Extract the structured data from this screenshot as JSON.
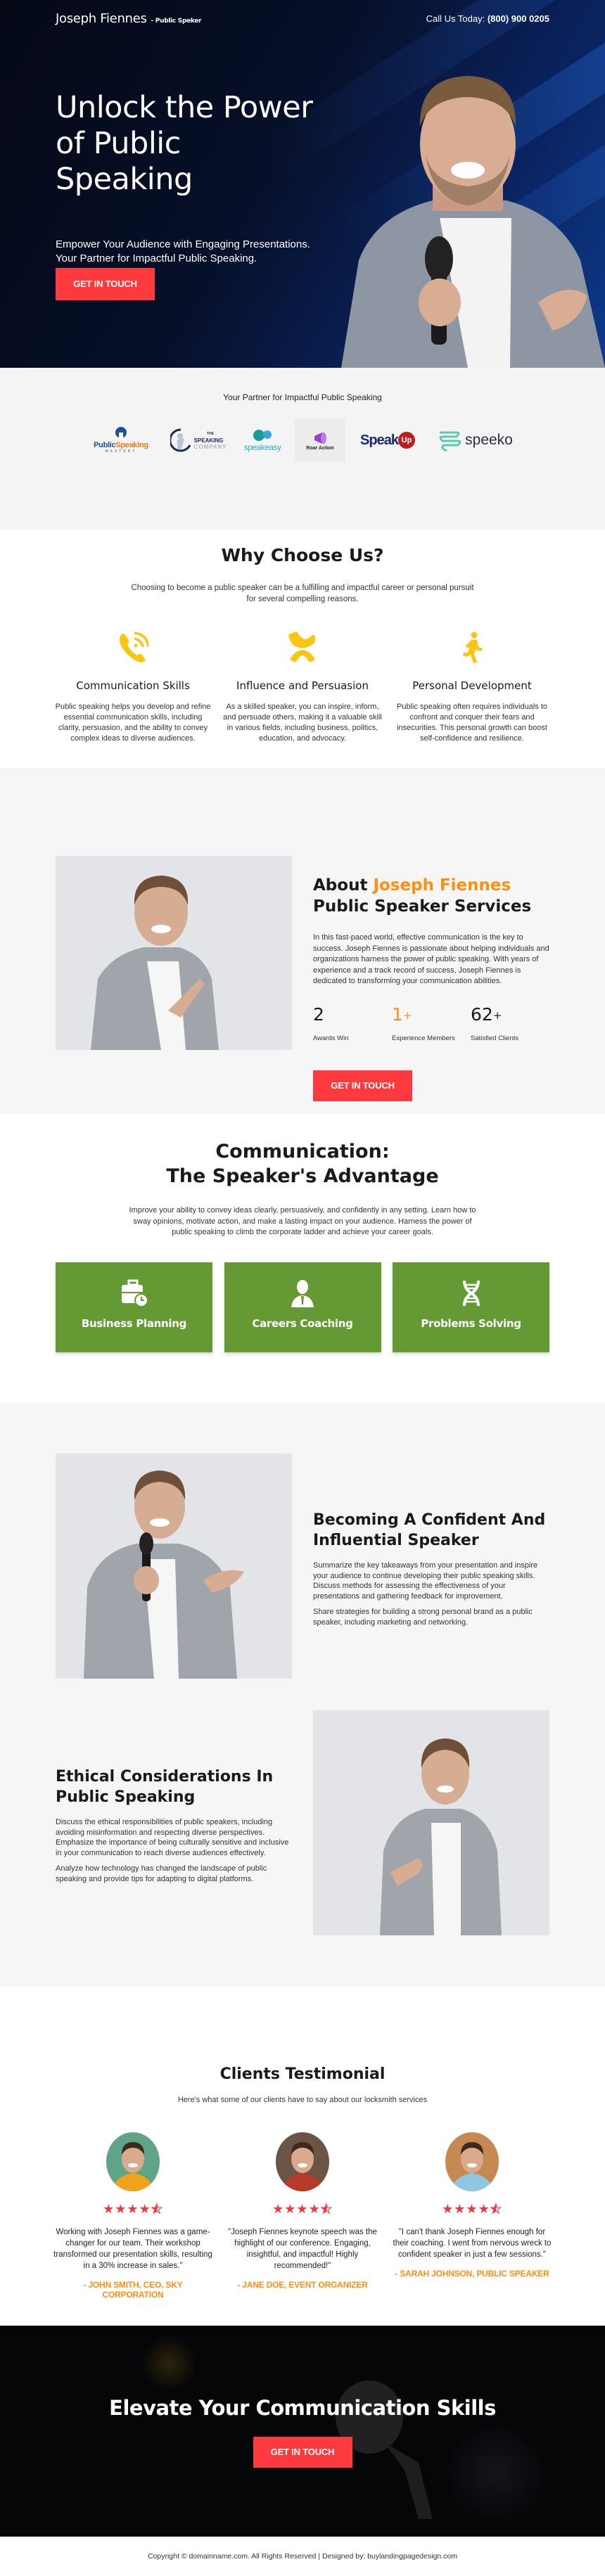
{
  "header": {
    "brand": "Joseph Fiennes",
    "brand_tag": "- Public Speker",
    "phone_label": "Call Us Today:",
    "phone_number": "(800) 900 0205"
  },
  "hero": {
    "title": "Unlock the Power of Public Speaking",
    "subtitle": "Empower Your Audience with Engaging Presentations. Your Partner for Impactful Public Speaking.",
    "cta": "GET IN TOUCH"
  },
  "partners": {
    "title": "Your Partner for Impactful Public Speaking",
    "logos": [
      {
        "name": "Public Speaking Mastery",
        "part1": "Public",
        "part2": "Speaking",
        "tag": "MASTERY"
      },
      {
        "name": "The Speaking Company",
        "top": "THE",
        "mid": "SPEAKING",
        "bot": "COMPANY"
      },
      {
        "name": "Speak Easy",
        "text": "speakeasy"
      },
      {
        "name": "Roar Action",
        "text": "Roar Action"
      },
      {
        "name": "SpeakUp",
        "part1": "Speak",
        "part2": "Up"
      },
      {
        "name": "Speeko",
        "text": "speeko"
      }
    ]
  },
  "why": {
    "title": "Why Choose Us?",
    "lead": "Choosing to become a public speaker can be a fulfilling and impactful career or personal pursuit for several compelling reasons.",
    "accent": "#fdc512",
    "items": [
      {
        "icon": "phone-call-icon",
        "title": "Communication Skills",
        "text": "Public speaking helps you develop and refine essential communication skills, including clarity, persuasion, and the ability to convey complex ideas to diverse audiences."
      },
      {
        "icon": "handshake-icon",
        "title": "Influence and Persuasion",
        "text": "As a skilled speaker, you can inspire, inform, and persuade others, making it a valuable skill in various fields, including business, politics, education, and advocacy."
      },
      {
        "icon": "running-person-icon",
        "title": "Personal Development",
        "text": "Public speaking often requires individuals to confront and conquer their fears and insecurities. This personal growth can boost self-confidence and resilience."
      }
    ]
  },
  "about": {
    "title_pre": "About",
    "title_name": "Joseph Fiennes",
    "title_post": "Public Speaker Services",
    "text": "In this fast-paced world, effective communication is the key to success. Joseph Fiennes is passionate about helping individuals and organizations harness the power of public speaking. With years of experience and a track record of success, Joseph Fiennes is dedicated to transforming your communication abilities.",
    "stats": [
      {
        "value": "2",
        "suffix": "",
        "label": "Awards Win"
      },
      {
        "value": "1",
        "suffix": "+",
        "label": "Experience Members"
      },
      {
        "value": "62",
        "suffix": "+",
        "label": "Satisfied Clients"
      }
    ],
    "cta": "GET IN TOUCH"
  },
  "communication": {
    "title_line1": "Communication:",
    "title_line2": "The Speaker's Advantage",
    "lead": "Improve your ability to convey ideas clearly, persuasively, and confidently in any setting. Learn how to sway opinions, motivate action, and make a lasting impact on your audience. Harness the power of public speaking to climb the corporate ladder and achieve your career goals.",
    "card_color": "#659933",
    "cards": [
      {
        "icon": "briefcase-clock-icon",
        "label": "Business Planning"
      },
      {
        "icon": "person-tie-icon",
        "label": "Careers Coaching"
      },
      {
        "icon": "dna-icon",
        "label": "Problems Solving"
      }
    ]
  },
  "features": [
    {
      "title": "Becoming A Confident And Influential Speaker",
      "paragraphs": [
        "Summarize the key takeaways from your presentation and inspire your audience to continue developing their public speaking skills. Discuss methods for assessing the effectiveness of your presentations and gathering feedback for improvement.",
        "Share strategies for building a strong personal brand as a public speaker, including marketing and networking."
      ]
    },
    {
      "title": "Ethical Considerations In Public Speaking",
      "paragraphs": [
        "Discuss the ethical responsibilities of public speakers, including avoiding misinformation and respecting diverse perspectives. Emphasize the importance of being culturally sensitive and inclusive in your communication to reach diverse audiences effectively.",
        "Analyze how technology has changed the landscape of public speaking and provide tips for adapting to digital platforms."
      ]
    }
  ],
  "testimonials": {
    "title": "Clients Testimonial",
    "lead": "Here's what some of our clients have to say about our locksmith services",
    "items": [
      {
        "rating": 4.5,
        "quote": "Working with Joseph Fiennes was a game-changer for our team. Their workshop transformed our presentation skills, resulting in a 30% increase in sales.\"",
        "author": "- JOHN SMITH, CEO, SKY CORPORATION",
        "bg": "#5fa487",
        "shirt": "#f0a318"
      },
      {
        "rating": 4.5,
        "quote": "\"Joseph Fiennes keynote speech was the highlight of our conference. Engaging, insightful, and impactful! Highly recommended!\"",
        "author": "- JANE DOE, EVENT ORGANIZER",
        "bg": "#6b5446",
        "shirt": "#b83a2a"
      },
      {
        "rating": 4.5,
        "quote": "\"I can't thank Joseph Fiennes enough for their coaching. I went from nervous wreck to confident speaker in just a few sessions.\"",
        "author": "- SARAH JOHNSON, PUBLIC SPEAKER",
        "bg": "#c48a52",
        "shirt": "#8fc6e0"
      }
    ]
  },
  "cta": {
    "title": "Elevate Your Communication Skills",
    "button": "GET IN TOUCH"
  },
  "footer": {
    "text": "Copyright © domainname.com. All Rights Reserved | Designed by: buylandingpagedesign.com"
  },
  "colors": {
    "accent_red": "#fe3a3e",
    "accent_orange": "#fd8f11",
    "accent_yellow": "#fdc512",
    "green": "#659933"
  }
}
